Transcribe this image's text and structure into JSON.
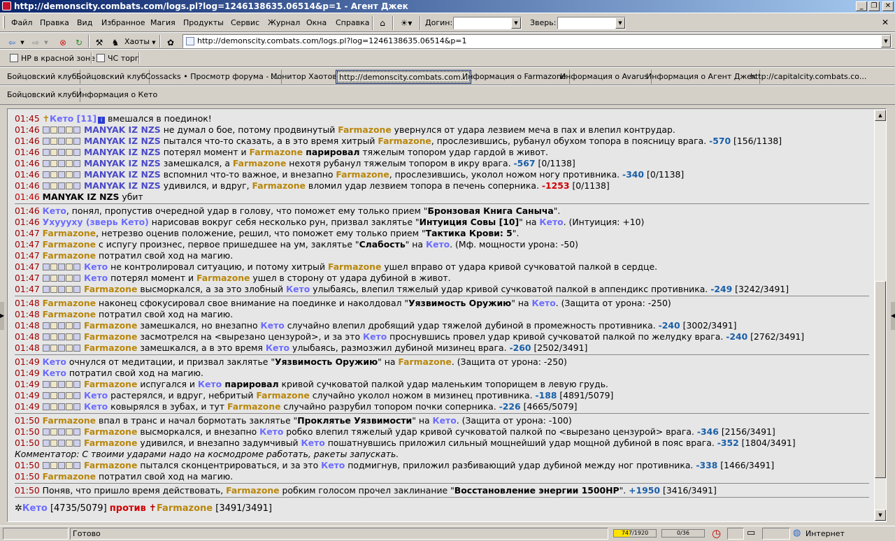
{
  "window": {
    "title": "http://demonscity.combats.com/logs.pl?log=1246138635.06514&p=1 - Агент Джек",
    "min_label": "_",
    "max_label": "❐",
    "close_label": "✕"
  },
  "menu": {
    "items": [
      "Файл",
      "Правка",
      "Вид",
      "Избранное",
      "Магия",
      "Продукты",
      "Сервис",
      "Журнал",
      "Окна",
      "Справка"
    ],
    "login_label": "Догин:",
    "beast_label": "Зверь:",
    "close_x": "✕"
  },
  "toolbar": {
    "chaos_label": "Хаоты",
    "address": "http://demonscity.combats.com/logs.pl?log=1246138635.06514&p=1"
  },
  "links": [
    {
      "label": "НР в красной зоне"
    },
    {
      "label": "ЧС торг"
    }
  ],
  "tabs_row1": [
    {
      "label": "Бойцовский клуб",
      "active": false
    },
    {
      "label": "Бойцовский клуб",
      "active": false
    },
    {
      "label": "Cossacks • Просмотр форума - ...",
      "active": false
    },
    {
      "label": "Монитор Хаотов",
      "active": false
    },
    {
      "label": "http://demonscity.combats.com...",
      "active": true
    },
    {
      "label": "Информация о Farmazone",
      "active": false
    },
    {
      "label": "Информация о Avarus",
      "active": false
    },
    {
      "label": "Информация о Агент Джек",
      "active": false
    },
    {
      "label": "http://capitalcity.combats.co...",
      "active": false
    }
  ],
  "tabs_row2": [
    {
      "label": "Бойцовский клуб"
    },
    {
      "label": "Информация о Кето"
    }
  ],
  "log": [
    {
      "type": "line",
      "parts": [
        {
          "c": "t",
          "v": "01:45 "
        },
        {
          "c": "p1",
          "v": "Кето [11]"
        },
        {
          "c": "",
          "v": " вмешался в поединок!"
        }
      ],
      "icon": "cross"
    },
    {
      "type": "line",
      "parts": [
        {
          "c": "t",
          "v": "01:46 "
        },
        {
          "c": "ic",
          "v": "5"
        },
        {
          "c": "p3",
          "v": " MANYAK IZ NZS"
        },
        {
          "c": "",
          "v": " не думал о бое, потому продвинутый "
        },
        {
          "c": "p2",
          "v": "Farmazone"
        },
        {
          "c": "",
          "v": " увернулся от удара лезвием меча в пах и влепил контрудар."
        }
      ]
    },
    {
      "type": "line",
      "parts": [
        {
          "c": "t",
          "v": "01:46 "
        },
        {
          "c": "ic",
          "v": "5"
        },
        {
          "c": "p3",
          "v": " MANYAK IZ NZS"
        },
        {
          "c": "",
          "v": " пытался что-то сказать, а в это время хитрый "
        },
        {
          "c": "p2",
          "v": "Farmazone"
        },
        {
          "c": "",
          "v": ", прослезившись, рубанул обухом топора в поясницу врага. "
        },
        {
          "c": "dmg",
          "v": "-570"
        },
        {
          "c": "hp",
          "v": " [156/1138]"
        }
      ]
    },
    {
      "type": "line",
      "parts": [
        {
          "c": "t",
          "v": "01:46 "
        },
        {
          "c": "ic",
          "v": "5"
        },
        {
          "c": "p3",
          "v": " MANYAK IZ NZS"
        },
        {
          "c": "",
          "v": " потерял момент и "
        },
        {
          "c": "p2",
          "v": "Farmazone"
        },
        {
          "c": "sp",
          "v": " парировал"
        },
        {
          "c": "",
          "v": " тяжелым топором удар гардой в живот."
        }
      ]
    },
    {
      "type": "line",
      "parts": [
        {
          "c": "t",
          "v": "01:46 "
        },
        {
          "c": "ic",
          "v": "5"
        },
        {
          "c": "p3",
          "v": " MANYAK IZ NZS"
        },
        {
          "c": "",
          "v": " замешкался, а "
        },
        {
          "c": "p2",
          "v": "Farmazone"
        },
        {
          "c": "",
          "v": " нехотя рубанул тяжелым топором в икру врага. "
        },
        {
          "c": "dmg",
          "v": "-567"
        },
        {
          "c": "hp",
          "v": " [0/1138]"
        }
      ]
    },
    {
      "type": "line",
      "parts": [
        {
          "c": "t",
          "v": "01:46 "
        },
        {
          "c": "ic",
          "v": "5"
        },
        {
          "c": "p3",
          "v": " MANYAK IZ NZS"
        },
        {
          "c": "",
          "v": " вспомнил что-то важное, и внезапно "
        },
        {
          "c": "p2",
          "v": "Farmazone"
        },
        {
          "c": "",
          "v": ", прослезившись, уколол ножом ногу противника. "
        },
        {
          "c": "dmg",
          "v": "-340"
        },
        {
          "c": "hp",
          "v": " [0/1138]"
        }
      ]
    },
    {
      "type": "line",
      "parts": [
        {
          "c": "t",
          "v": "01:46 "
        },
        {
          "c": "ic",
          "v": "5"
        },
        {
          "c": "p3",
          "v": " MANYAK IZ NZS"
        },
        {
          "c": "",
          "v": " удивился, и вдруг, "
        },
        {
          "c": "p2",
          "v": "Farmazone"
        },
        {
          "c": "",
          "v": " вломил удар лезвием топора в печень соперника. "
        },
        {
          "c": "dmg red",
          "v": "-1253"
        },
        {
          "c": "hp",
          "v": " [0/1138]"
        }
      ]
    },
    {
      "type": "line",
      "parts": [
        {
          "c": "t red",
          "v": "01:46 "
        },
        {
          "c": "sp",
          "v": "MANYAK IZ NZS"
        },
        {
          "c": "",
          "v": " убит"
        }
      ]
    },
    {
      "type": "hr"
    },
    {
      "type": "line",
      "parts": [
        {
          "c": "t",
          "v": "01:46 "
        },
        {
          "c": "p1",
          "v": "Кето"
        },
        {
          "c": "",
          "v": ", понял, пропустив очередной удар в голову, что поможет ему только прием \""
        },
        {
          "c": "sp",
          "v": "Бронзовая Книга Саныча"
        },
        {
          "c": "",
          "v": "\"."
        }
      ]
    },
    {
      "type": "line",
      "parts": [
        {
          "c": "t",
          "v": "01:46 "
        },
        {
          "c": "p1",
          "v": "Ухуууху (зверь Кето)"
        },
        {
          "c": "",
          "v": " нарисовав вокруг себя несколько рун, призвал заклятье \""
        },
        {
          "c": "sp",
          "v": "Интуиция Совы [10]"
        },
        {
          "c": "",
          "v": "\" на "
        },
        {
          "c": "p1",
          "v": "Кето"
        },
        {
          "c": "",
          "v": ". (Интуиция: +10)"
        }
      ]
    },
    {
      "type": "line",
      "parts": [
        {
          "c": "t",
          "v": "01:47 "
        },
        {
          "c": "p2",
          "v": "Farmazone"
        },
        {
          "c": "",
          "v": ", нетрезво оценив положение, решил, что поможет ему только прием \""
        },
        {
          "c": "sp",
          "v": "Тактика Крови: 5"
        },
        {
          "c": "",
          "v": "\"."
        }
      ]
    },
    {
      "type": "line",
      "parts": [
        {
          "c": "t",
          "v": "01:47 "
        },
        {
          "c": "p2",
          "v": "Farmazone"
        },
        {
          "c": "",
          "v": " с испугу произнес, первое пришедшее на ум, заклятье \""
        },
        {
          "c": "sp",
          "v": "Слабость"
        },
        {
          "c": "",
          "v": "\" на "
        },
        {
          "c": "p1",
          "v": "Кето"
        },
        {
          "c": "",
          "v": ". (Мф. мощности урона: -50)"
        }
      ]
    },
    {
      "type": "line",
      "parts": [
        {
          "c": "t",
          "v": "01:47 "
        },
        {
          "c": "p2",
          "v": "Farmazone"
        },
        {
          "c": "",
          "v": " потратил свой ход на магию."
        }
      ]
    },
    {
      "type": "line",
      "parts": [
        {
          "c": "t",
          "v": "01:47 "
        },
        {
          "c": "ic",
          "v": "5"
        },
        {
          "c": "p1",
          "v": " Кето"
        },
        {
          "c": "",
          "v": " не контролировал ситуацию, и потому хитрый "
        },
        {
          "c": "p2",
          "v": "Farmazone"
        },
        {
          "c": "",
          "v": " ушел вправо от удара кривой сучковатой палкой в сердце."
        }
      ]
    },
    {
      "type": "line",
      "parts": [
        {
          "c": "t",
          "v": "01:47 "
        },
        {
          "c": "ic",
          "v": "5"
        },
        {
          "c": "p1",
          "v": " Кето"
        },
        {
          "c": "",
          "v": " потерял момент и "
        },
        {
          "c": "p2",
          "v": "Farmazone"
        },
        {
          "c": "",
          "v": " ушел в сторону от удара дубиной в живот."
        }
      ]
    },
    {
      "type": "line",
      "parts": [
        {
          "c": "t",
          "v": "01:47 "
        },
        {
          "c": "ic",
          "v": "5"
        },
        {
          "c": "p2",
          "v": " Farmazone"
        },
        {
          "c": "",
          "v": " высморкался, а за это злобный "
        },
        {
          "c": "p1",
          "v": "Кето"
        },
        {
          "c": "",
          "v": " улыбаясь, влепил тяжелый удар кривой сучковатой палкой в аппендикс противника. "
        },
        {
          "c": "dmg",
          "v": "-249"
        },
        {
          "c": "hp",
          "v": " [3242/3491]"
        }
      ]
    },
    {
      "type": "hr"
    },
    {
      "type": "line",
      "parts": [
        {
          "c": "t",
          "v": "01:48 "
        },
        {
          "c": "p2",
          "v": "Farmazone"
        },
        {
          "c": "",
          "v": " наконец сфокусировал свое внимание на поединке и наколдовал \""
        },
        {
          "c": "sp",
          "v": "Уязвимость Оружию"
        },
        {
          "c": "",
          "v": "\" на "
        },
        {
          "c": "p1",
          "v": "Кето"
        },
        {
          "c": "",
          "v": ". (Защита от урона: -250)"
        }
      ]
    },
    {
      "type": "line",
      "parts": [
        {
          "c": "t",
          "v": "01:48 "
        },
        {
          "c": "p2",
          "v": "Farmazone"
        },
        {
          "c": "",
          "v": " потратил свой ход на магию."
        }
      ]
    },
    {
      "type": "line",
      "parts": [
        {
          "c": "t",
          "v": "01:48 "
        },
        {
          "c": "ic",
          "v": "5"
        },
        {
          "c": "p2",
          "v": " Farmazone"
        },
        {
          "c": "",
          "v": " замешкался, но внезапно "
        },
        {
          "c": "p1",
          "v": "Кето"
        },
        {
          "c": "",
          "v": " случайно влепил дробящий удар тяжелой дубиной в промежность противника. "
        },
        {
          "c": "dmg",
          "v": "-240"
        },
        {
          "c": "hp",
          "v": " [3002/3491]"
        }
      ]
    },
    {
      "type": "line",
      "parts": [
        {
          "c": "t",
          "v": "01:48 "
        },
        {
          "c": "ic",
          "v": "5"
        },
        {
          "c": "p2",
          "v": " Farmazone"
        },
        {
          "c": "",
          "v": " засмотрелся на <вырезано цензурой>, и за это "
        },
        {
          "c": "p1",
          "v": "Кето"
        },
        {
          "c": "",
          "v": " проснувшись провел удар кривой сучковатой палкой по желудку врага. "
        },
        {
          "c": "dmg",
          "v": "-240"
        },
        {
          "c": "hp",
          "v": " [2762/3491]"
        }
      ]
    },
    {
      "type": "line",
      "parts": [
        {
          "c": "t",
          "v": "01:48 "
        },
        {
          "c": "ic",
          "v": "5"
        },
        {
          "c": "p2",
          "v": " Farmazone"
        },
        {
          "c": "",
          "v": " замешкался, а в это время "
        },
        {
          "c": "p1",
          "v": "Кето"
        },
        {
          "c": "",
          "v": " улыбаясь, размозжил дубиной мизинец врага. "
        },
        {
          "c": "dmg",
          "v": "-260"
        },
        {
          "c": "hp",
          "v": " [2502/3491]"
        }
      ]
    },
    {
      "type": "hr"
    },
    {
      "type": "line",
      "parts": [
        {
          "c": "t",
          "v": "01:49 "
        },
        {
          "c": "p1",
          "v": "Кето"
        },
        {
          "c": "",
          "v": " очнулся от медитации, и призвал заклятье \""
        },
        {
          "c": "sp",
          "v": "Уязвимость Оружию"
        },
        {
          "c": "",
          "v": "\" на "
        },
        {
          "c": "p2",
          "v": "Farmazone"
        },
        {
          "c": "",
          "v": ". (Защита от урона: -250)"
        }
      ]
    },
    {
      "type": "line",
      "parts": [
        {
          "c": "t",
          "v": "01:49 "
        },
        {
          "c": "p1",
          "v": "Кето"
        },
        {
          "c": "",
          "v": " потратил свой ход на магию."
        }
      ]
    },
    {
      "type": "line",
      "parts": [
        {
          "c": "t",
          "v": "01:49 "
        },
        {
          "c": "ic",
          "v": "5"
        },
        {
          "c": "p2",
          "v": " Farmazone"
        },
        {
          "c": "",
          "v": " испугался и "
        },
        {
          "c": "p1",
          "v": "Кето"
        },
        {
          "c": "sp",
          "v": " парировал"
        },
        {
          "c": "",
          "v": " кривой сучковатой палкой удар маленьким топорищем в левую грудь."
        }
      ]
    },
    {
      "type": "line",
      "parts": [
        {
          "c": "t",
          "v": "01:49 "
        },
        {
          "c": "ic",
          "v": "5"
        },
        {
          "c": "p1",
          "v": " Кето"
        },
        {
          "c": "",
          "v": " растерялся, и вдруг, небритый "
        },
        {
          "c": "p2",
          "v": "Farmazone"
        },
        {
          "c": "",
          "v": " случайно уколол ножом в мизинец противника. "
        },
        {
          "c": "dmg",
          "v": "-188"
        },
        {
          "c": "hp",
          "v": " [4891/5079]"
        }
      ]
    },
    {
      "type": "line",
      "parts": [
        {
          "c": "t",
          "v": "01:49 "
        },
        {
          "c": "ic",
          "v": "5"
        },
        {
          "c": "p1",
          "v": " Кето"
        },
        {
          "c": "",
          "v": " ковырялся в зубах, и тут "
        },
        {
          "c": "p2",
          "v": "Farmazone"
        },
        {
          "c": "",
          "v": " случайно разрубил топором почки соперника. "
        },
        {
          "c": "dmg",
          "v": "-226"
        },
        {
          "c": "hp",
          "v": " [4665/5079]"
        }
      ]
    },
    {
      "type": "hr"
    },
    {
      "type": "line",
      "parts": [
        {
          "c": "t",
          "v": "01:50 "
        },
        {
          "c": "p2",
          "v": "Farmazone"
        },
        {
          "c": "",
          "v": " впал в транс и начал бормотать заклятье \""
        },
        {
          "c": "sp",
          "v": "Проклятье Уязвимости"
        },
        {
          "c": "",
          "v": "\" на "
        },
        {
          "c": "p1",
          "v": "Кето"
        },
        {
          "c": "",
          "v": ". (Защита от урона: -100)"
        }
      ]
    },
    {
      "type": "line",
      "parts": [
        {
          "c": "t",
          "v": "01:50 "
        },
        {
          "c": "ic",
          "v": "5"
        },
        {
          "c": "p2",
          "v": " Farmazone"
        },
        {
          "c": "",
          "v": " высморкался, и внезапно "
        },
        {
          "c": "p1",
          "v": "Кето"
        },
        {
          "c": "",
          "v": " робко влепил тяжелый удар кривой сучковатой палкой по <вырезано цензурой> врага. "
        },
        {
          "c": "dmg",
          "v": "-346"
        },
        {
          "c": "hp",
          "v": " [2156/3491]"
        }
      ]
    },
    {
      "type": "line",
      "parts": [
        {
          "c": "t",
          "v": "01:50 "
        },
        {
          "c": "ic",
          "v": "5"
        },
        {
          "c": "p2",
          "v": " Farmazone"
        },
        {
          "c": "",
          "v": " удивился, и внезапно задумчивый "
        },
        {
          "c": "p1",
          "v": "Кето"
        },
        {
          "c": "",
          "v": " пошатнувшись приложил сильный мощнейший удар мощной дубиной в пояс врага. "
        },
        {
          "c": "dmg",
          "v": "-352"
        },
        {
          "c": "hp",
          "v": " [1804/3491]"
        }
      ]
    },
    {
      "type": "line",
      "parts": [
        {
          "c": "ital",
          "v": "Комментатор: С твоими ударами надо на космодроме работать, ракеты запускать."
        }
      ]
    },
    {
      "type": "line",
      "parts": [
        {
          "c": "t",
          "v": "01:50 "
        },
        {
          "c": "ic",
          "v": "5"
        },
        {
          "c": "p2",
          "v": " Farmazone"
        },
        {
          "c": "",
          "v": " пытался сконцентрироваться, и за это "
        },
        {
          "c": "p1",
          "v": "Кето"
        },
        {
          "c": "",
          "v": " подмигнув, приложил разбивающий удар дубиной между ног противника. "
        },
        {
          "c": "dmg",
          "v": "-338"
        },
        {
          "c": "hp",
          "v": " [1466/3491]"
        }
      ]
    },
    {
      "type": "line",
      "parts": [
        {
          "c": "t",
          "v": "01:50 "
        },
        {
          "c": "p2",
          "v": "Farmazone"
        },
        {
          "c": "",
          "v": " потратил свой ход на магию."
        }
      ]
    },
    {
      "type": "hr"
    },
    {
      "type": "line",
      "parts": [
        {
          "c": "t",
          "v": "01:50 "
        },
        {
          "c": "",
          "v": "Поняв, что пришло время действовать, "
        },
        {
          "c": "p2",
          "v": "Farmazone"
        },
        {
          "c": "",
          "v": " робким голосом прочел заклинание \""
        },
        {
          "c": "sp",
          "v": "Восстановление энергии 1500HP"
        },
        {
          "c": "",
          "v": "\". "
        },
        {
          "c": "dmg",
          "v": "+1950"
        },
        {
          "c": "hp",
          "v": " [3416/3491]"
        }
      ]
    },
    {
      "type": "hr"
    }
  ],
  "summary": {
    "left_name": "Кето",
    "left_hp": " [4735/5079] ",
    "versus": "против",
    "right_name": "Farmazone",
    "right_hp": " [3491/3491]"
  },
  "status": {
    "text": "Готово",
    "progress1_label": "747/1920",
    "progress1_fraction": 0.39,
    "progress2_label": "0/36",
    "progress2_fraction": 0.0,
    "zone": "Интернет"
  },
  "colors": {
    "time": "#a00000",
    "keto": "#6b6bff",
    "farmazone": "#b8860b",
    "damage": "#1a5fa8",
    "crit": "#d00000"
  }
}
